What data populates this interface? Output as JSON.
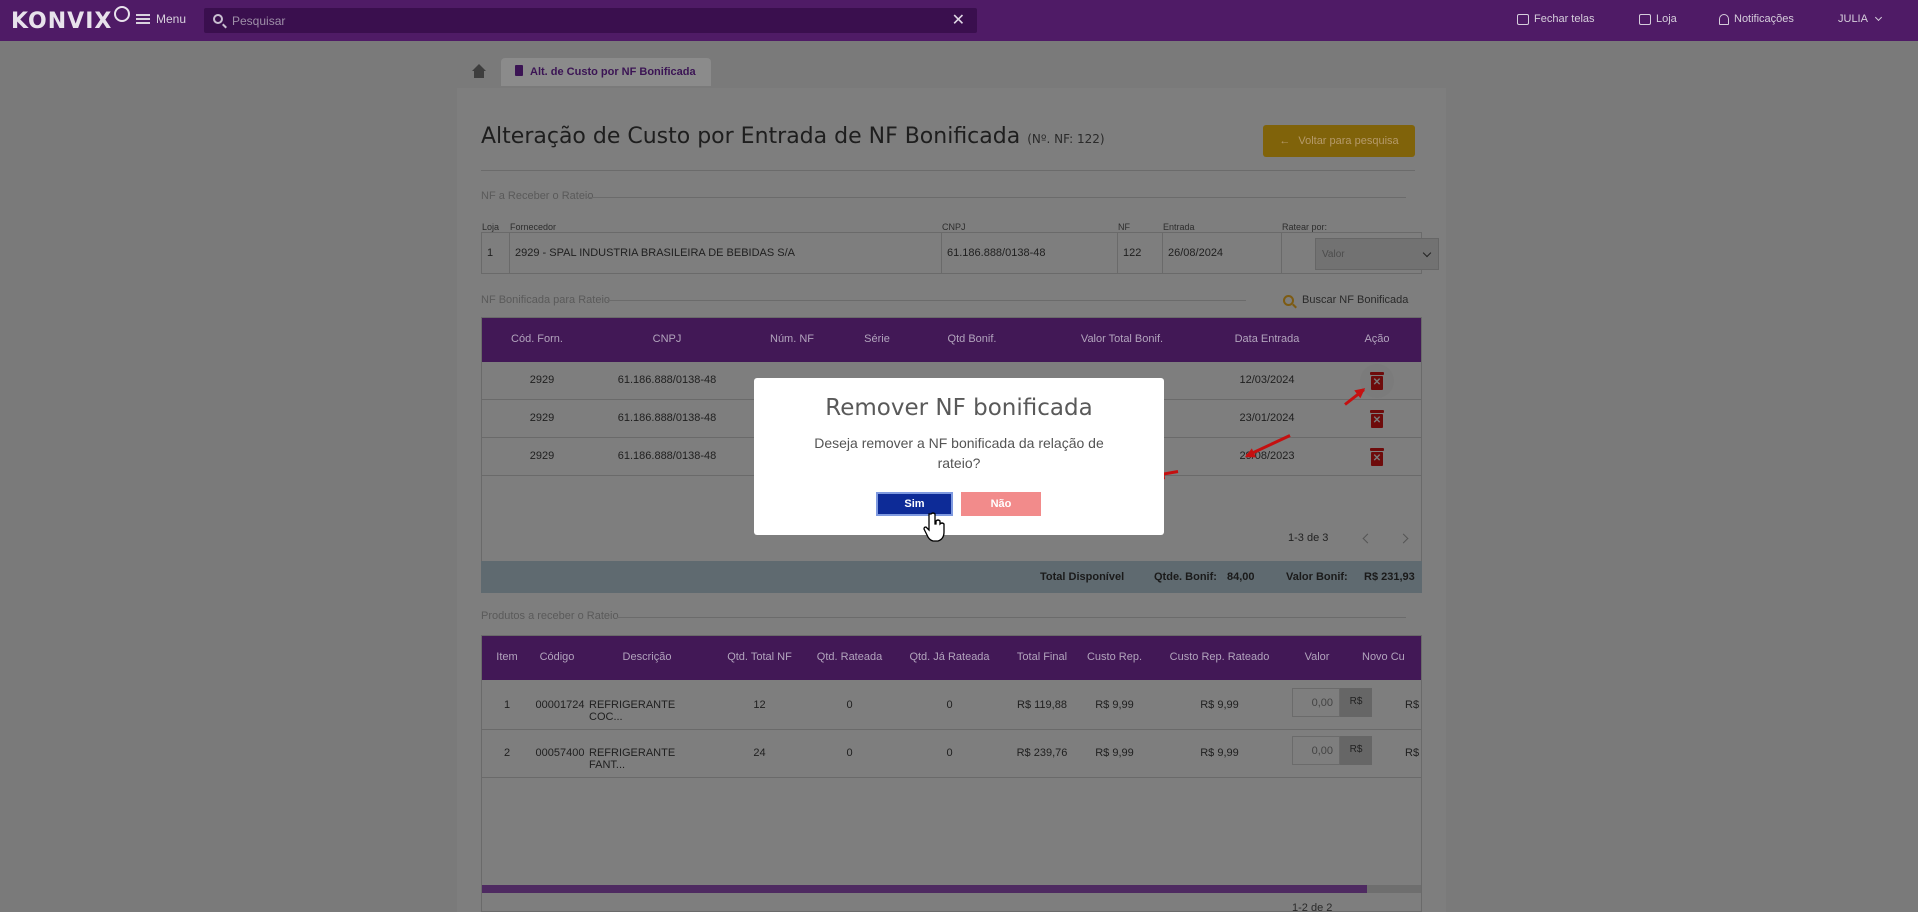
{
  "topbar": {
    "logo": "KONVIX",
    "menu_label": "Menu",
    "search_placeholder": "Pesquisar",
    "fechar_telas": "Fechar telas",
    "loja": "Loja",
    "notificacoes": "Notificações",
    "user": "JULIA"
  },
  "tab": {
    "label": "Alt. de Custo por NF Bonificada"
  },
  "page": {
    "title": "Alteração de Custo por Entrada de NF Bonificada",
    "subtitle": "(Nº. NF: 122)",
    "back_button": "Voltar para pesquisa"
  },
  "nf_section": {
    "label": "NF a Receber o Rateio",
    "fields": {
      "loja": "Loja",
      "fornecedor": "Fornecedor",
      "cnpj": "CNPJ",
      "nf": "NF",
      "entrada": "Entrada",
      "ratear_por": "Ratear por:"
    },
    "values": {
      "loja": "1",
      "fornecedor": "2929 - SPAL INDUSTRIA BRASILEIRA DE BEBIDAS S/A",
      "cnpj": "61.186.888/0138-48",
      "nf": "122",
      "entrada": "26/08/2024",
      "ratear_placeholder": "Valor"
    }
  },
  "bonif_section": {
    "label": "NF Bonificada para Rateio",
    "buscar": "Buscar NF Bonificada",
    "headers": [
      "Cód. Forn.",
      "CNPJ",
      "Núm. NF",
      "Série",
      "Qtd Bonif.",
      "Valor Total Bonif.",
      "Data Entrada",
      "Ação"
    ],
    "rows": [
      {
        "cod": "2929",
        "cnpj": "61.186.888/0138-48",
        "data": "12/03/2024"
      },
      {
        "cod": "2929",
        "cnpj": "61.186.888/0138-48",
        "data": "23/01/2024"
      },
      {
        "cod": "2929",
        "cnpj": "61.186.888/0138-48",
        "data": "29/08/2023"
      }
    ],
    "pager": "1-3 de 3"
  },
  "totals": {
    "label": "Total Disponível",
    "qtde_label": "Qtde. Bonif:",
    "qtde_value": "84,00",
    "valor_label": "Valor Bonif:",
    "valor_value": "R$ 231,93"
  },
  "produtos_section": {
    "label": "Produtos a receber o Rateio",
    "headers": [
      "Item",
      "Código",
      "Descrição",
      "Qtd. Total NF",
      "Qtd. Rateada",
      "Qtd. Já Rateada",
      "Total Final",
      "Custo Rep.",
      "Custo Rep. Rateado",
      "Valor",
      "Novo Cu"
    ],
    "rows": [
      {
        "item": "1",
        "codigo": "00001724",
        "descricao": "REFRIGERANTE COC...",
        "qtd_total": "12",
        "qtd_rateada": "0",
        "qtd_ja": "0",
        "total_final": "R$ 119,88",
        "custo_rep": "R$ 9,99",
        "custo_rateado": "R$ 9,99",
        "valor": "0,00",
        "moeda": "R$",
        "novo": "R$"
      },
      {
        "item": "2",
        "codigo": "00057400",
        "descricao": "REFRIGERANTE FANT...",
        "qtd_total": "24",
        "qtd_rateada": "0",
        "qtd_ja": "0",
        "total_final": "R$ 239,76",
        "custo_rep": "R$ 9,99",
        "custo_rateado": "R$ 9,99",
        "valor": "0,00",
        "moeda": "R$",
        "novo": "R$"
      }
    ],
    "pager": "1-2 de 2"
  },
  "modal": {
    "title": "Remover NF bonificada",
    "text": "Deseja remover a NF bonificada da relação de rateio?",
    "yes": "Sim",
    "no": "Não"
  },
  "colors": {
    "brand": "#4f1b66",
    "accent": "#0d2b97",
    "danger": "#c51010"
  }
}
